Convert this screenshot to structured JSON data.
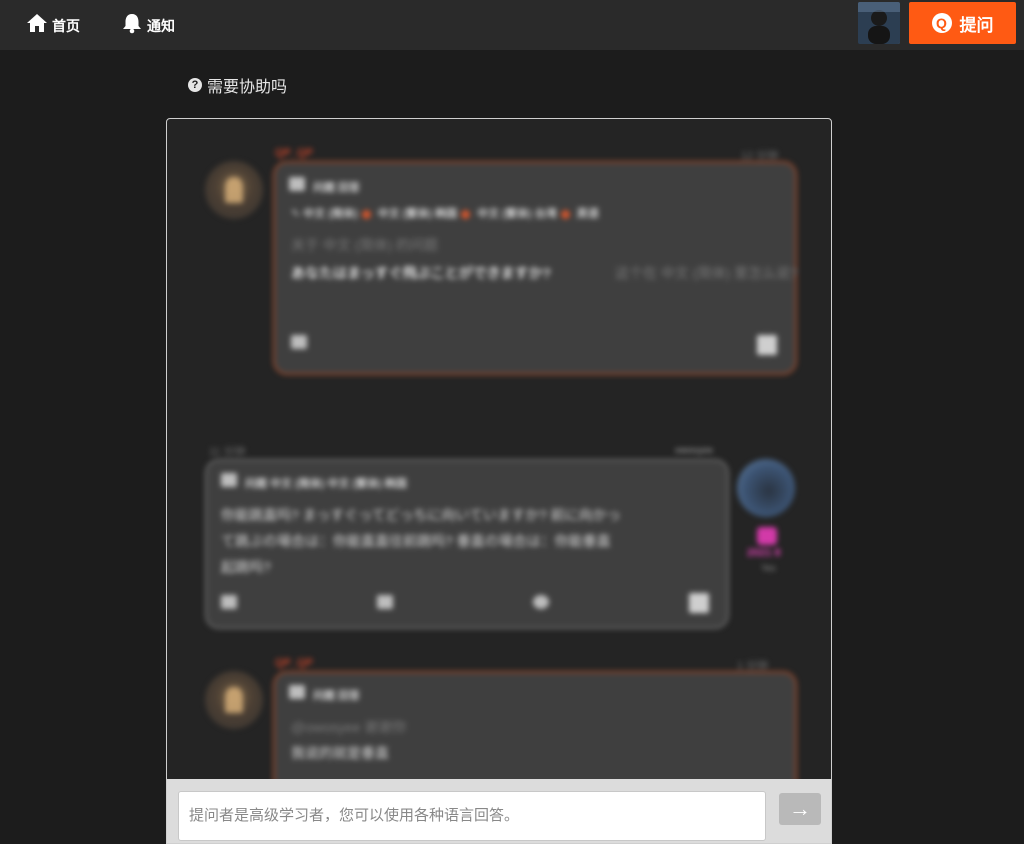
{
  "nav": {
    "home_label": "首页",
    "notify_label": "通知",
    "ask_label": "提问",
    "ask_icon": "Q"
  },
  "help": {
    "label": "需要协助吗",
    "icon": "?"
  },
  "chat": {
    "msg1": {
      "name": "QP_QP",
      "time": "12 分钟",
      "meta": "问题 回答",
      "langs": [
        "中文 (简体)",
        "中文 (繁体)",
        "韩国",
        "中文 (繁体)",
        "台湾",
        "英语"
      ],
      "title": "关于 中文 (简体) 的问题",
      "body": "あなたはまっすぐ飛ぶことができますか?",
      "body_dim": "这个在 中文 (简体) 里怎么说?"
    },
    "msg2": {
      "time": "11 分钟",
      "user": "owosyee",
      "meta": "问题 中文 (简体) 中文 (繁体) 韩国",
      "body1": "你能跳直吗?  まっすぐってどっちに向いていますか?  前に向かっ",
      "body2": "て跳ぶの場合は：你能直直往前跳吗?  垂直の場合は：你能垂直",
      "body3": "起跳吗?",
      "badge": "2021 8",
      "sub": "Yes"
    },
    "msg3": {
      "name": "QP_QP",
      "time": "1 分钟",
      "meta": "问题 回答",
      "mention": "@owosyee 谢谢你",
      "body": "我说的就是垂直"
    }
  },
  "input": {
    "placeholder": "提问者是高级学习者，您可以使用各种语言回答。",
    "send_icon": "→"
  },
  "colors": {
    "accent": "#ff5a13",
    "background": "#1c1c1c",
    "bubble": "#3f3f3f",
    "bubble_border": "#9a4a2c"
  }
}
